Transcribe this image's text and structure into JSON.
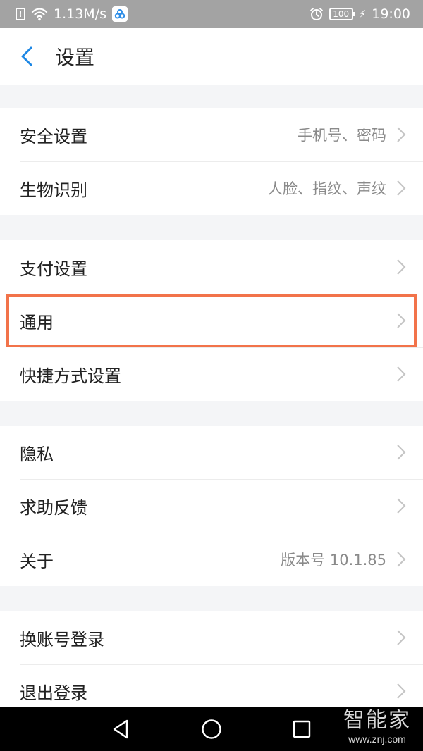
{
  "status_bar": {
    "net_speed": "1.13M/s",
    "battery": "100",
    "time": "19:00",
    "icons": [
      "alert-icon",
      "wifi-icon",
      "app-notification-icon",
      "alarm-icon",
      "battery-icon",
      "charging-icon"
    ]
  },
  "header": {
    "title": "设置",
    "back_icon": "chevron-left-icon",
    "accent_color": "#1e88e5"
  },
  "groups": [
    {
      "items": [
        {
          "label": "安全设置",
          "value": "手机号、密码"
        },
        {
          "label": "生物识别",
          "value": "人脸、指纹、声纹"
        }
      ]
    },
    {
      "items": [
        {
          "label": "支付设置",
          "value": ""
        },
        {
          "label": "通用",
          "value": "",
          "highlighted": true
        },
        {
          "label": "快捷方式设置",
          "value": ""
        }
      ]
    },
    {
      "items": [
        {
          "label": "隐私",
          "value": ""
        },
        {
          "label": "求助反馈",
          "value": ""
        },
        {
          "label": "关于",
          "value": "版本号 10.1.85"
        }
      ]
    },
    {
      "items": [
        {
          "label": "换账号登录",
          "value": ""
        },
        {
          "label": "退出登录",
          "value": ""
        }
      ]
    }
  ],
  "highlight_color": "#f2734a",
  "nav_bar": {
    "icons": [
      "back-triangle-icon",
      "home-circle-icon",
      "recents-square-icon"
    ]
  },
  "watermark": {
    "top": "智能家",
    "bottom": "www.znj.com"
  }
}
